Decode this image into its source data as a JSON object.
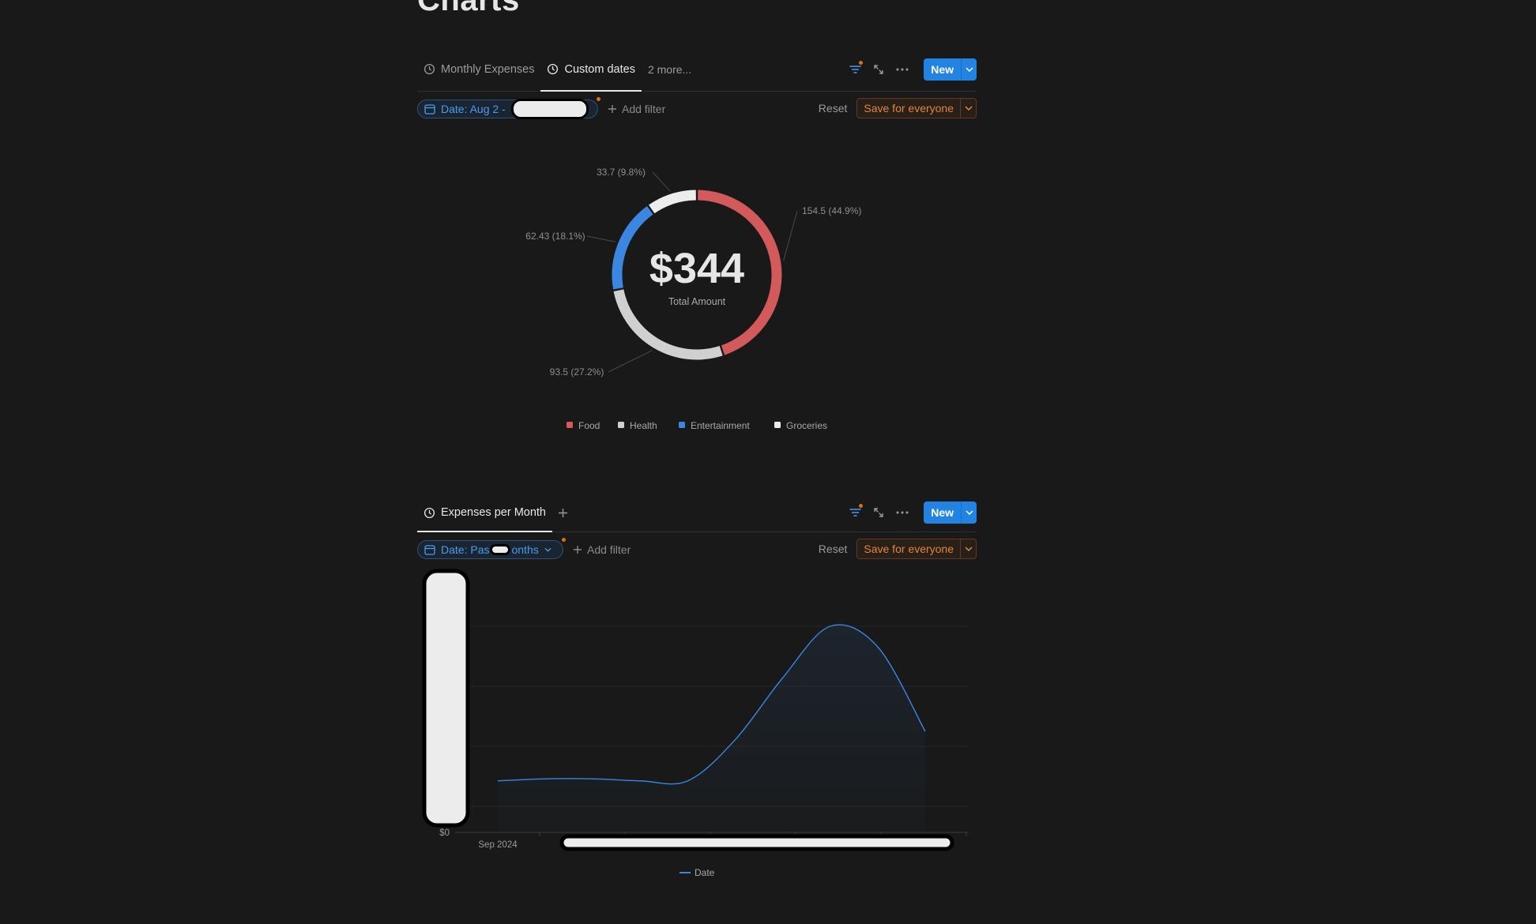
{
  "page": {
    "title": "Charts"
  },
  "view1": {
    "tabs": [
      {
        "label": "Monthly Expenses",
        "active": false
      },
      {
        "label": "Custom dates",
        "active": true
      }
    ],
    "more_tabs": "2 more...",
    "new_label": "New",
    "filter_chip": "Date: Aug 2 -",
    "add_filter": "Add filter",
    "reset": "Reset",
    "save": "Save for everyone"
  },
  "donut": {
    "chart_data": {
      "type": "pie",
      "center_value": "$344",
      "center_label": "Total Amount",
      "slices": [
        {
          "name": "Food",
          "value": 154.5,
          "label": "154.5 (44.9%)",
          "color": "#d25a5a"
        },
        {
          "name": "Health",
          "value": 93.5,
          "label": "93.5 (27.2%)",
          "color": "#d0d0d0"
        },
        {
          "name": "Entertainment",
          "value": 62.43,
          "label": "62.43 (18.1%)",
          "color": "#3a86e0"
        },
        {
          "name": "Groceries",
          "value": 33.7,
          "label": "33.7 (9.8%)",
          "color": "#ededed"
        }
      ]
    }
  },
  "view2": {
    "tab_label": "Expenses per Month",
    "new_label": "New",
    "filter_chip_left": "Date: Pas",
    "filter_chip_right": "onths",
    "add_filter": "Add filter",
    "reset": "Reset",
    "save": "Save for everyone"
  },
  "area": {
    "chart_data": {
      "type": "area",
      "y_tick_label": "$0",
      "x_tick_label": "Sep 2024",
      "legend": "Date",
      "color": "#3a86e0",
      "series": [
        {
          "name": "Date",
          "values": [
            0.25,
            0.26,
            0.26,
            0.25,
            0.25,
            0.45,
            0.75,
            1.0,
            0.9,
            0.49
          ]
        }
      ]
    }
  }
}
